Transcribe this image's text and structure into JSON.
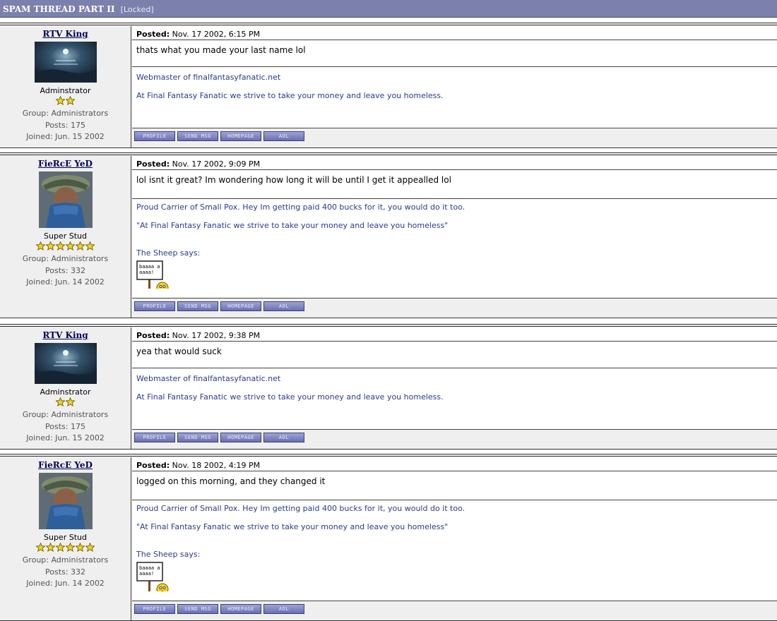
{
  "thread": {
    "title": "SPAM THREAD PART II",
    "status": "[Locked]"
  },
  "buttons": {
    "profile": "PROFILE",
    "send_msg": "SEND MSG",
    "homepage": "HOMEPAGE",
    "aol": "AOL"
  },
  "icons": {
    "rank_star": "star-icon",
    "sheep": "sheep-sign-icon"
  },
  "colors": {
    "title_bar": "#7b80ad",
    "username": "#000055",
    "signature": "#2b3a8c",
    "row_bg": "#efefef"
  },
  "posts": [
    {
      "username": "RTV King",
      "rank": "Adminstrator",
      "stars": 2,
      "group": "Group: Administrators",
      "posts": "Posts: 175",
      "joined": "Joined: Jun. 15 2002",
      "posted_label": "Posted:",
      "posted": "Nov. 17 2002, 6:15 PM",
      "body": "thats what you made your last name lol",
      "sig1": "Webmaster of finalfantasyfanatic.net",
      "sig2": "At Final Fantasy Fanatic we strive to take your money and leave you homeless."
    },
    {
      "username": "FieRcE YeD",
      "rank": "Super Stud",
      "stars": 6,
      "group": "Group: Administrators",
      "posts": "Posts: 332",
      "joined": "Joined: Jun. 14 2002",
      "posted_label": "Posted:",
      "posted": "Nov. 17 2002, 9:09 PM",
      "body": "lol isnt it great? Im wondering how long it will be until I get it appealled lol",
      "sig1": "Proud Carrier of Small Pox. Hey Im getting paid 400 bucks for it, you would do it too.",
      "sig2": "\"At Final Fantasy Fanatic we strive to take your money and leave you homeless\"",
      "sig3": "The Sheep says:",
      "sheep_text": "baaaa aaaaa!"
    },
    {
      "username": "RTV King",
      "rank": "Adminstrator",
      "stars": 2,
      "group": "Group: Administrators",
      "posts": "Posts: 175",
      "joined": "Joined: Jun. 15 2002",
      "posted_label": "Posted:",
      "posted": "Nov. 17 2002, 9:38 PM",
      "body": "yea that would suck",
      "sig1": "Webmaster of finalfantasyfanatic.net",
      "sig2": "At Final Fantasy Fanatic we strive to take your money and leave you homeless."
    },
    {
      "username": "FieRcE YeD",
      "rank": "Super Stud",
      "stars": 6,
      "group": "Group: Administrators",
      "posts": "Posts: 332",
      "joined": "Joined: Jun. 14 2002",
      "posted_label": "Posted:",
      "posted": "Nov. 18 2002, 4:19 PM",
      "body": "logged on this morning, and they changed it",
      "sig1": "Proud Carrier of Small Pox. Hey Im getting paid 400 bucks for it, you would do it too.",
      "sig2": "\"At Final Fantasy Fanatic we strive to take your money and leave you homeless\"",
      "sig3": "The Sheep says:",
      "sheep_text": "baaaa aaaaa!"
    }
  ]
}
